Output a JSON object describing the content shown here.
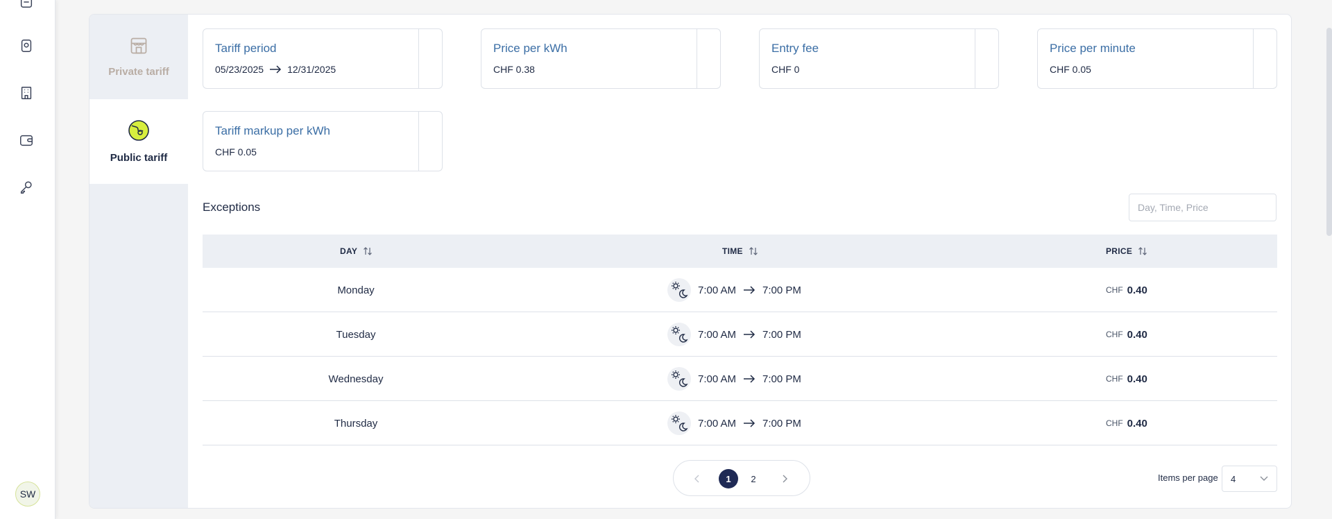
{
  "nav": {
    "items": [
      {
        "icon": "document-icon"
      },
      {
        "icon": "station-icon"
      },
      {
        "icon": "building-icon"
      },
      {
        "icon": "wallet-icon"
      },
      {
        "icon": "key-icon"
      }
    ],
    "avatar_initials": "SW"
  },
  "tabs": {
    "private": {
      "label": "Private tariff",
      "icon": "storefront-icon"
    },
    "public": {
      "label": "Public tariff",
      "icon": "globe-icon"
    }
  },
  "cards": {
    "tariff_period": {
      "title": "Tariff period",
      "start": "05/23/2025",
      "end": "12/31/2025"
    },
    "price_per_kwh": {
      "title": "Price per kWh",
      "value": "CHF 0.38"
    },
    "entry_fee": {
      "title": "Entry fee",
      "value": "CHF 0"
    },
    "price_per_minute": {
      "title": "Price per minute",
      "value": "CHF 0.05"
    },
    "markup_per_kwh": {
      "title": "Tariff markup per kWh",
      "value": "CHF 0.05"
    }
  },
  "exceptions": {
    "title": "Exceptions",
    "search_placeholder": "Day, Time, Price",
    "columns": {
      "day": "DAY",
      "time": "TIME",
      "price": "PRICE"
    },
    "rows": [
      {
        "day": "Monday",
        "start": "7:00 AM",
        "end": "7:00 PM",
        "currency": "CHF",
        "price": "0.40"
      },
      {
        "day": "Tuesday",
        "start": "7:00 AM",
        "end": "7:00 PM",
        "currency": "CHF",
        "price": "0.40"
      },
      {
        "day": "Wednesday",
        "start": "7:00 AM",
        "end": "7:00 PM",
        "currency": "CHF",
        "price": "0.40"
      },
      {
        "day": "Thursday",
        "start": "7:00 AM",
        "end": "7:00 PM",
        "currency": "CHF",
        "price": "0.40"
      }
    ]
  },
  "pagination": {
    "pages": [
      "1",
      "2"
    ],
    "current": "1",
    "items_per_page_label": "Items per page",
    "items_per_page": "4"
  },
  "colors": {
    "accent": "#3b6ea5",
    "navy": "#1f2a55",
    "globe_fill": "#d7ee3e"
  }
}
